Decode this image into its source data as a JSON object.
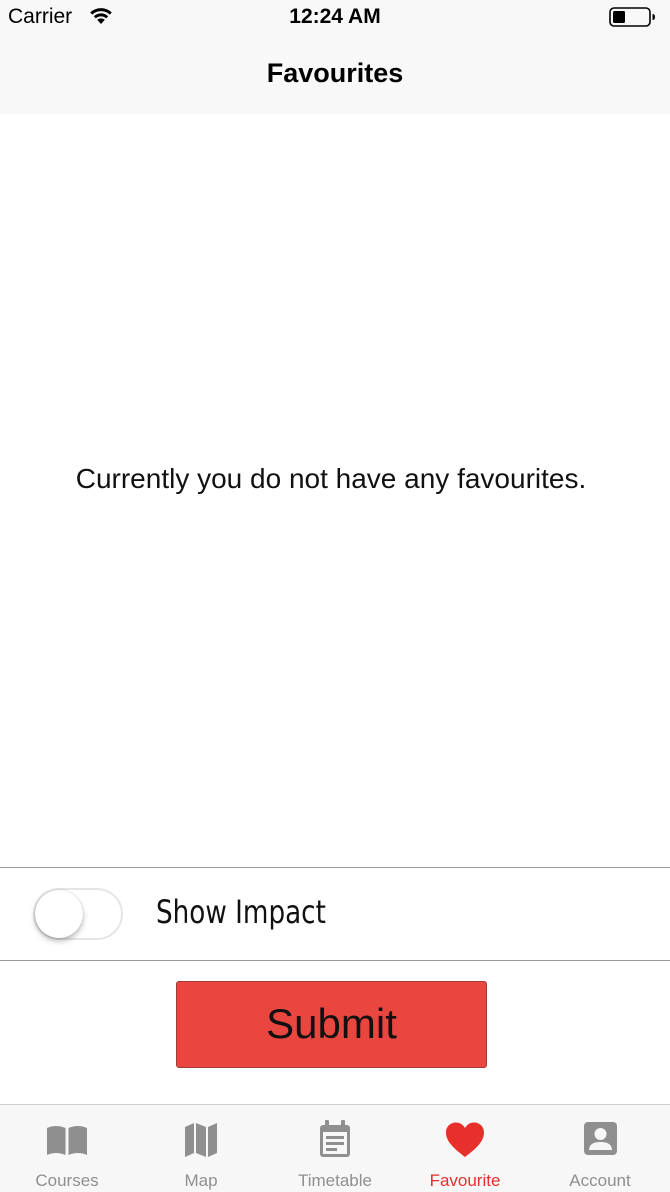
{
  "status_bar": {
    "carrier": "Carrier",
    "time": "12:24 AM"
  },
  "nav": {
    "title": "Favourites"
  },
  "content": {
    "empty_message": "Currently you do not have any favourites."
  },
  "toggle": {
    "label": "Show Impact",
    "on": false
  },
  "submit": {
    "label": "Submit"
  },
  "tab_bar": {
    "items": [
      {
        "label": "Courses",
        "icon": "book-icon",
        "active": false
      },
      {
        "label": "Map",
        "icon": "map-icon",
        "active": false
      },
      {
        "label": "Timetable",
        "icon": "calendar-icon",
        "active": false
      },
      {
        "label": "Favourite",
        "icon": "heart-icon",
        "active": true
      },
      {
        "label": "Account",
        "icon": "account-icon",
        "active": false
      }
    ]
  },
  "colors": {
    "accent": "#e7302c",
    "button_bg": "#ea4640",
    "inactive_tab": "#8f8f8f"
  }
}
